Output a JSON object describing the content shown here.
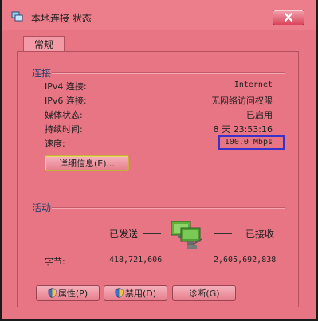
{
  "window": {
    "title": "本地连接 状态"
  },
  "tabs": [
    {
      "label": "常规"
    }
  ],
  "connection": {
    "section_label": "连接",
    "rows": [
      {
        "label": "IPv4 连接:",
        "value": "Internet"
      },
      {
        "label": "IPv6 连接:",
        "value": "无网络访问权限"
      },
      {
        "label": "媒体状态:",
        "value": "已启用"
      },
      {
        "label": "持续时间:",
        "value": "8 天 23:53:16"
      },
      {
        "label": "速度:",
        "value": "100.0 Mbps"
      }
    ],
    "details_button": "详细信息(E)..."
  },
  "activity": {
    "section_label": "活动",
    "sent_label": "已发送",
    "received_label": "已接收",
    "bytes_label": "字节:",
    "bytes_sent": "418,721,606",
    "bytes_received": "2,605,692,838"
  },
  "buttons": {
    "properties": "属性(P)",
    "disable": "禁用(D)",
    "diagnose": "诊断(G)"
  },
  "icons": {
    "title": "network-connection-icon",
    "close": "close-icon",
    "network": "network-activity-icon",
    "shield": "uac-shield-icon"
  },
  "colors": {
    "window_tint": "#e87584",
    "highlight_box": "#3a32c8",
    "focus_border": "#c7b03a"
  }
}
